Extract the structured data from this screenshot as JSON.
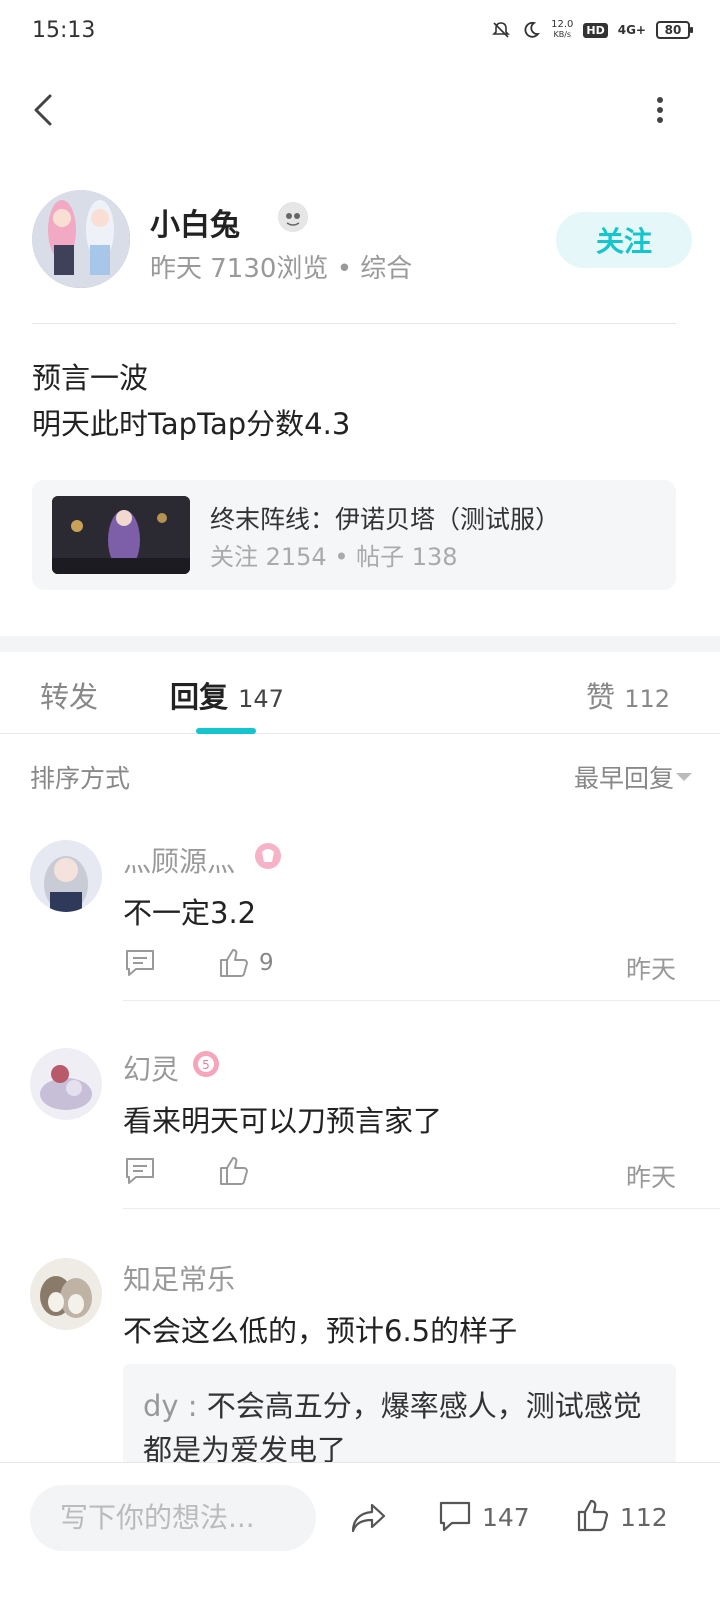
{
  "status_bar": {
    "time": "15:13",
    "net_speed_value": "12.0",
    "net_speed_unit": "KB/s",
    "hd_label": "HD",
    "signal_label": "4G+",
    "battery": "80"
  },
  "author": {
    "name": "小白兔",
    "meta": "昨天 7130浏览 • 综合",
    "follow_label": "关注"
  },
  "post": {
    "line1": "预言一波",
    "line2": "明天此时TapTap分数4.3"
  },
  "game": {
    "title": "终末阵线：伊诺贝塔（测试服）",
    "stats": "关注 2154 • 帖子 138"
  },
  "tabs": {
    "repost": "转发",
    "reply": "回复",
    "reply_count": "147",
    "like": "赞",
    "like_count": "112"
  },
  "sort": {
    "label": "排序方式",
    "value": "最早回复"
  },
  "comments": [
    {
      "name": "灬顾源灬",
      "text": "不一定3.2",
      "likes": "9",
      "time": "昨天"
    },
    {
      "name": "幻灵",
      "text": "看来明天可以刀预言家了",
      "likes": "",
      "time": "昨天"
    },
    {
      "name": "知足常乐",
      "text": "不会这么低的，预计6.5的样子",
      "sub_reply_user": "dy",
      "sub_reply_text": "不会高五分，爆率感人，测试感觉都是为爱发电了"
    }
  ],
  "bottom_bar": {
    "input_placeholder": "写下你的想法...",
    "comment_count": "147",
    "like_count": "112"
  },
  "colors": {
    "accent": "#15c5ce",
    "follow_bg": "#e5f7f8"
  }
}
